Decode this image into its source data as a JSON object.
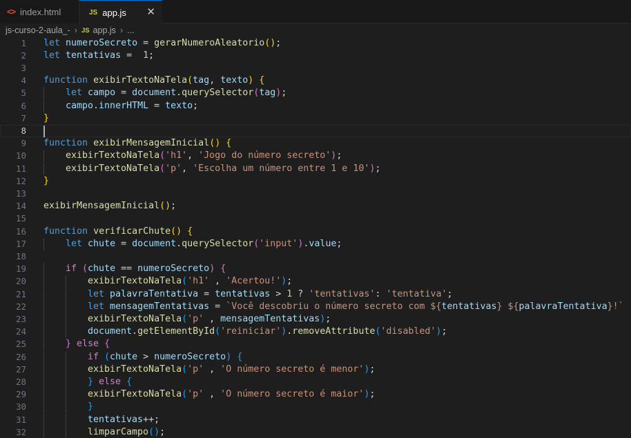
{
  "tabs": [
    {
      "label": "index.html",
      "icon": "html-icon",
      "active": false
    },
    {
      "label": "app.js",
      "icon": "js-icon",
      "active": true
    }
  ],
  "breadcrumb": {
    "folder": "js-curso-2-aula_-",
    "file": "app.js",
    "ellipsis": "..."
  },
  "editor": {
    "active_line": 8,
    "colors": {
      "keyword": "#569cd6",
      "control": "#c586c0",
      "variable": "#9cdcfe",
      "function": "#dcdcaa",
      "string": "#ce9178",
      "number": "#b5cea8",
      "bracket1": "#ffd700",
      "bracket2": "#da70d6",
      "bracket3": "#179fff"
    },
    "lines": [
      {
        "n": "1",
        "indent": 0,
        "tokens": [
          [
            "kw",
            "let"
          ],
          [
            "op",
            " "
          ],
          [
            "var",
            "numeroSecreto"
          ],
          [
            "op",
            " = "
          ],
          [
            "fn",
            "gerarNumeroAleatorio"
          ],
          [
            "b1",
            "()"
          ],
          [
            "op",
            ";"
          ]
        ]
      },
      {
        "n": "2",
        "indent": 0,
        "tokens": [
          [
            "kw",
            "let"
          ],
          [
            "op",
            " "
          ],
          [
            "var",
            "tentativas"
          ],
          [
            "op",
            " =  "
          ],
          [
            "num",
            "1"
          ],
          [
            "op",
            ";"
          ]
        ]
      },
      {
        "n": "3",
        "indent": 0,
        "tokens": []
      },
      {
        "n": "4",
        "indent": 0,
        "tokens": [
          [
            "kw",
            "function"
          ],
          [
            "op",
            " "
          ],
          [
            "fn",
            "exibirTextoNaTela"
          ],
          [
            "b1",
            "("
          ],
          [
            "var",
            "tag"
          ],
          [
            "op",
            ", "
          ],
          [
            "var",
            "texto"
          ],
          [
            "b1",
            ")"
          ],
          [
            "op",
            " "
          ],
          [
            "b1",
            "{"
          ]
        ]
      },
      {
        "n": "5",
        "indent": 1,
        "tokens": [
          [
            "kw",
            "let"
          ],
          [
            "op",
            " "
          ],
          [
            "var",
            "campo"
          ],
          [
            "op",
            " = "
          ],
          [
            "var",
            "document"
          ],
          [
            "op",
            "."
          ],
          [
            "fn",
            "querySelector"
          ],
          [
            "b2",
            "("
          ],
          [
            "var",
            "tag"
          ],
          [
            "b2",
            ")"
          ],
          [
            "op",
            ";"
          ]
        ]
      },
      {
        "n": "6",
        "indent": 1,
        "tokens": [
          [
            "var",
            "campo"
          ],
          [
            "op",
            "."
          ],
          [
            "var",
            "innerHTML"
          ],
          [
            "op",
            " = "
          ],
          [
            "var",
            "texto"
          ],
          [
            "op",
            ";"
          ]
        ]
      },
      {
        "n": "7",
        "indent": 0,
        "tokens": [
          [
            "b1",
            "}"
          ]
        ]
      },
      {
        "n": "8",
        "indent": 0,
        "tokens": []
      },
      {
        "n": "9",
        "indent": 0,
        "tokens": [
          [
            "kw",
            "function"
          ],
          [
            "op",
            " "
          ],
          [
            "fn",
            "exibirMensagemInicial"
          ],
          [
            "b1",
            "()"
          ],
          [
            "op",
            " "
          ],
          [
            "b1",
            "{"
          ]
        ]
      },
      {
        "n": "10",
        "indent": 1,
        "tokens": [
          [
            "fn",
            "exibirTextoNaTela"
          ],
          [
            "b2",
            "("
          ],
          [
            "str",
            "'h1'"
          ],
          [
            "op",
            ", "
          ],
          [
            "str",
            "'Jogo do número secreto'"
          ],
          [
            "b2",
            ")"
          ],
          [
            "op",
            ";"
          ]
        ]
      },
      {
        "n": "11",
        "indent": 1,
        "tokens": [
          [
            "fn",
            "exibirTextoNaTela"
          ],
          [
            "b2",
            "("
          ],
          [
            "str",
            "'p'"
          ],
          [
            "op",
            ", "
          ],
          [
            "str",
            "'Escolha um número entre 1 e 10'"
          ],
          [
            "b2",
            ")"
          ],
          [
            "op",
            ";"
          ]
        ]
      },
      {
        "n": "12",
        "indent": 0,
        "tokens": [
          [
            "b1",
            "}"
          ]
        ]
      },
      {
        "n": "13",
        "indent": 0,
        "tokens": []
      },
      {
        "n": "14",
        "indent": 0,
        "tokens": [
          [
            "fn",
            "exibirMensagemInicial"
          ],
          [
            "b1",
            "()"
          ],
          [
            "op",
            ";"
          ]
        ]
      },
      {
        "n": "15",
        "indent": 0,
        "tokens": []
      },
      {
        "n": "16",
        "indent": 0,
        "tokens": [
          [
            "kw",
            "function"
          ],
          [
            "op",
            " "
          ],
          [
            "fn",
            "verificarChute"
          ],
          [
            "b1",
            "()"
          ],
          [
            "op",
            " "
          ],
          [
            "b1",
            "{"
          ]
        ]
      },
      {
        "n": "17",
        "indent": 1,
        "tokens": [
          [
            "kw",
            "let"
          ],
          [
            "op",
            " "
          ],
          [
            "var",
            "chute"
          ],
          [
            "op",
            " = "
          ],
          [
            "var",
            "document"
          ],
          [
            "op",
            "."
          ],
          [
            "fn",
            "querySelector"
          ],
          [
            "b2",
            "("
          ],
          [
            "str",
            "'input'"
          ],
          [
            "b2",
            ")"
          ],
          [
            "op",
            "."
          ],
          [
            "var",
            "value"
          ],
          [
            "op",
            ";"
          ]
        ]
      },
      {
        "n": "18",
        "indent": 0,
        "tokens": []
      },
      {
        "n": "19",
        "indent": 1,
        "tokens": [
          [
            "ctl",
            "if"
          ],
          [
            "op",
            " "
          ],
          [
            "b2",
            "("
          ],
          [
            "var",
            "chute"
          ],
          [
            "op",
            " == "
          ],
          [
            "var",
            "numeroSecreto"
          ],
          [
            "b2",
            ")"
          ],
          [
            "op",
            " "
          ],
          [
            "b2",
            "{"
          ]
        ]
      },
      {
        "n": "20",
        "indent": 2,
        "tokens": [
          [
            "fn",
            "exibirTextoNaTela"
          ],
          [
            "b3",
            "("
          ],
          [
            "str",
            "'h1'"
          ],
          [
            "op",
            " , "
          ],
          [
            "str",
            "'Acertou!'"
          ],
          [
            "b3",
            ")"
          ],
          [
            "op",
            ";"
          ]
        ]
      },
      {
        "n": "21",
        "indent": 2,
        "tokens": [
          [
            "kw",
            "let"
          ],
          [
            "op",
            " "
          ],
          [
            "var",
            "palavraTentativa"
          ],
          [
            "op",
            " = "
          ],
          [
            "var",
            "tentativas"
          ],
          [
            "op",
            " > "
          ],
          [
            "num",
            "1"
          ],
          [
            "op",
            " ? "
          ],
          [
            "str",
            "'tentativas'"
          ],
          [
            "op",
            ": "
          ],
          [
            "str",
            "'tentativa'"
          ],
          [
            "op",
            ";"
          ]
        ]
      },
      {
        "n": "22",
        "indent": 2,
        "tokens": [
          [
            "kw",
            "let"
          ],
          [
            "op",
            " "
          ],
          [
            "var",
            "mensagemTentativas"
          ],
          [
            "op",
            " = "
          ],
          [
            "str",
            "`Você descobriu o número secreto com ${"
          ],
          [
            "var",
            "tentativas"
          ],
          [
            "str",
            "} ${"
          ],
          [
            "var",
            "palavraTentativa"
          ],
          [
            "str",
            "}!`"
          ],
          [
            "op",
            " ;"
          ]
        ]
      },
      {
        "n": "23",
        "indent": 2,
        "tokens": [
          [
            "fn",
            "exibirTextoNaTela"
          ],
          [
            "b3",
            "("
          ],
          [
            "str",
            "'p'"
          ],
          [
            "op",
            " , "
          ],
          [
            "var",
            "mensagemTentativas"
          ],
          [
            "b3",
            ")"
          ],
          [
            "op",
            ";"
          ]
        ]
      },
      {
        "n": "24",
        "indent": 2,
        "tokens": [
          [
            "var",
            "document"
          ],
          [
            "op",
            "."
          ],
          [
            "fn",
            "getElementById"
          ],
          [
            "b3",
            "("
          ],
          [
            "str",
            "'reiniciar'"
          ],
          [
            "b3",
            ")"
          ],
          [
            "op",
            "."
          ],
          [
            "fn",
            "removeAttribute"
          ],
          [
            "b3",
            "("
          ],
          [
            "str",
            "'disabled'"
          ],
          [
            "b3",
            ")"
          ],
          [
            "op",
            ";"
          ]
        ]
      },
      {
        "n": "25",
        "indent": 1,
        "tokens": [
          [
            "b2",
            "}"
          ],
          [
            "op",
            " "
          ],
          [
            "ctl",
            "else"
          ],
          [
            "op",
            " "
          ],
          [
            "b2",
            "{"
          ]
        ]
      },
      {
        "n": "26",
        "indent": 2,
        "tokens": [
          [
            "ctl",
            "if"
          ],
          [
            "op",
            " "
          ],
          [
            "b3",
            "("
          ],
          [
            "var",
            "chute"
          ],
          [
            "op",
            " > "
          ],
          [
            "var",
            "numeroSecreto"
          ],
          [
            "b3",
            ")"
          ],
          [
            "op",
            " "
          ],
          [
            "b3",
            "{"
          ]
        ]
      },
      {
        "n": "27",
        "indent": 2,
        "tokens": [
          [
            "fn",
            "exibirTextoNaTela"
          ],
          [
            "b3",
            "("
          ],
          [
            "str",
            "'p'"
          ],
          [
            "op",
            " , "
          ],
          [
            "str",
            "'O número secreto é menor'"
          ],
          [
            "b3",
            ")"
          ],
          [
            "op",
            ";"
          ]
        ]
      },
      {
        "n": "28",
        "indent": 2,
        "tokens": [
          [
            "b3",
            "}"
          ],
          [
            "op",
            " "
          ],
          [
            "ctl",
            "else"
          ],
          [
            "op",
            " "
          ],
          [
            "b3",
            "{"
          ]
        ]
      },
      {
        "n": "29",
        "indent": 2,
        "tokens": [
          [
            "fn",
            "exibirTextoNaTela"
          ],
          [
            "b3",
            "("
          ],
          [
            "str",
            "'p'"
          ],
          [
            "op",
            " , "
          ],
          [
            "str",
            "'O número secreto é maior'"
          ],
          [
            "b3",
            ")"
          ],
          [
            "op",
            ";"
          ]
        ]
      },
      {
        "n": "30",
        "indent": 2,
        "tokens": [
          [
            "b3",
            "}"
          ]
        ]
      },
      {
        "n": "31",
        "indent": 2,
        "tokens": [
          [
            "var",
            "tentativas"
          ],
          [
            "op",
            "++;"
          ]
        ]
      },
      {
        "n": "32",
        "indent": 2,
        "tokens": [
          [
            "fn",
            "limparCampo"
          ],
          [
            "b3",
            "()"
          ],
          [
            "op",
            ";"
          ]
        ]
      }
    ]
  }
}
